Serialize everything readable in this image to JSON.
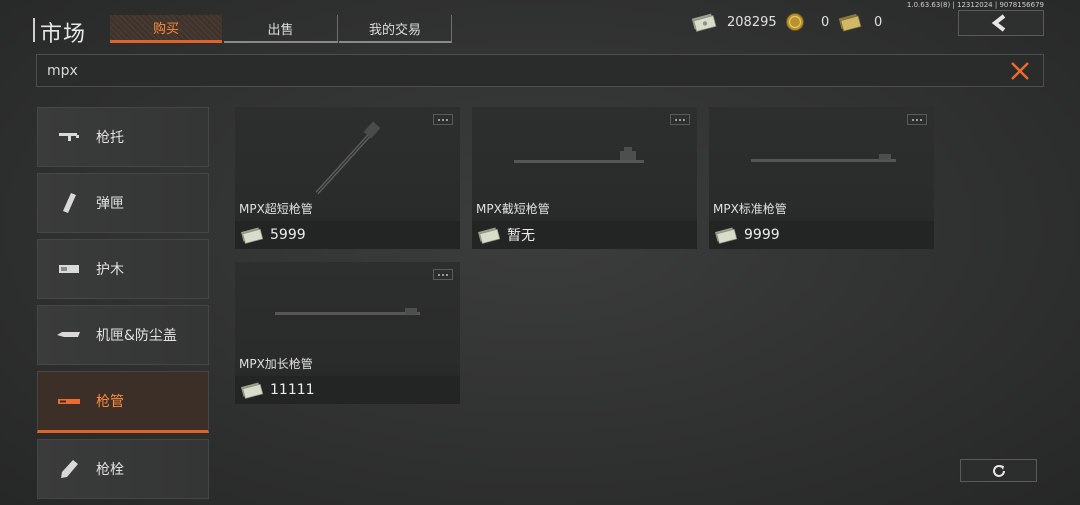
{
  "version": "1.0.63.63(8) | 12312024 | 9078156679",
  "header": {
    "title": "市场",
    "tabs": [
      {
        "label": "购买",
        "active": true
      },
      {
        "label": "出售",
        "active": false
      },
      {
        "label": "我的交易",
        "active": false
      }
    ]
  },
  "currencies": [
    {
      "icon": "cash-icon",
      "value": "208295"
    },
    {
      "icon": "gold-coin-icon",
      "value": "0"
    },
    {
      "icon": "gold-bar-icon",
      "value": "0"
    }
  ],
  "search": {
    "value": "mpx",
    "placeholder": ""
  },
  "categories": [
    {
      "label": "枪托",
      "icon": "stock-icon"
    },
    {
      "label": "弹匣",
      "icon": "magazine-icon"
    },
    {
      "label": "护木",
      "icon": "handguard-icon"
    },
    {
      "label": "机匣&防尘盖",
      "icon": "receiver-icon"
    },
    {
      "label": "枪管",
      "icon": "barrel-icon",
      "active": true
    },
    {
      "label": "枪栓",
      "icon": "bolt-icon"
    }
  ],
  "items": [
    {
      "name": "MPX超短枪管",
      "price": "5999"
    },
    {
      "name": "MPX截短枪管",
      "price": "暂无"
    },
    {
      "name": "MPX标准枪管",
      "price": "9999"
    },
    {
      "name": "MPX加长枪管",
      "price": "11111"
    }
  ],
  "colors": {
    "accent": "#e0642a",
    "accent_text": "#ff8c3d"
  }
}
